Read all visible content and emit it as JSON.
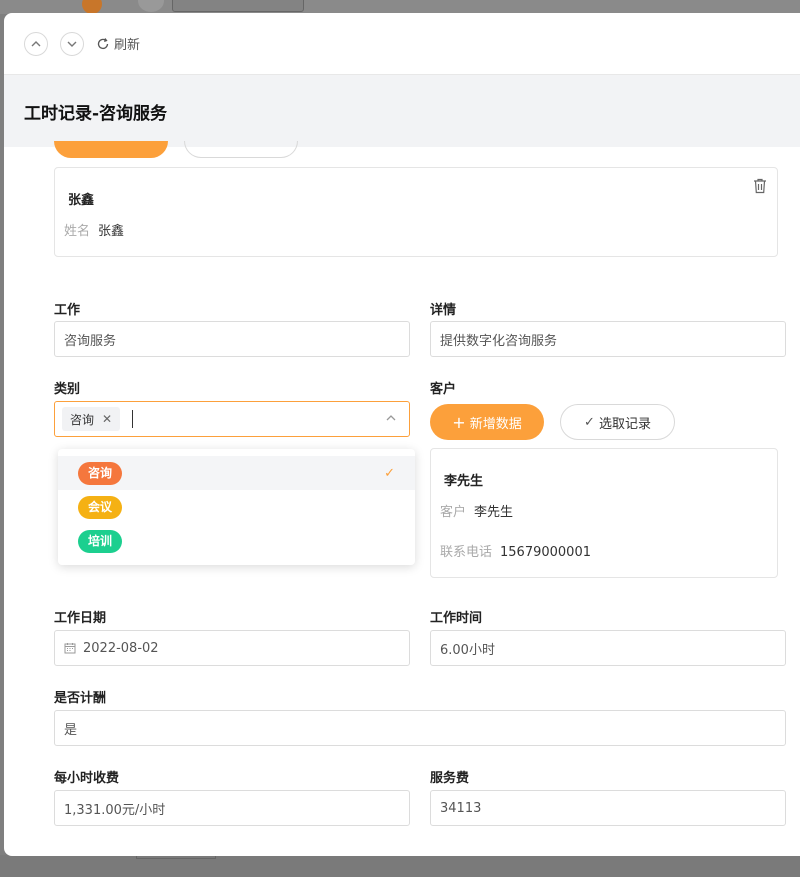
{
  "toolbar": {
    "up_icon": "chevron-up-icon",
    "down_icon": "chevron-down-icon",
    "refresh_label": "刷新"
  },
  "page_title": "工时记录-咨询服务",
  "employee_card": {
    "name": "张鑫",
    "field_label": "姓名",
    "field_value": "张鑫"
  },
  "form": {
    "work": {
      "label": "工作",
      "value": "咨询服务"
    },
    "details": {
      "label": "详情",
      "value": "提供数字化咨询服务"
    },
    "category": {
      "label": "类别",
      "selected_tag": "咨询",
      "options": [
        {
          "label": "咨询",
          "color": "#f5773d",
          "selected": true
        },
        {
          "label": "会议",
          "color": "#f5b114",
          "selected": false
        },
        {
          "label": "培训",
          "color": "#1ccf8f",
          "selected": false
        }
      ]
    },
    "customer": {
      "label": "客户",
      "add_button": "新增数据",
      "select_button": "选取记录",
      "card": {
        "name": "李先生",
        "customer_label": "客户",
        "customer_value": "李先生",
        "phone_label": "联系电话",
        "phone_value": "15679000001"
      }
    },
    "work_date": {
      "label": "工作日期",
      "value": "2022-08-02"
    },
    "work_time": {
      "label": "工作时间",
      "value": "6.00小时"
    },
    "billable": {
      "label": "是否计酬",
      "value": "是"
    },
    "hourly_rate": {
      "label": "每小时收费",
      "value": "1,331.00元/小时"
    },
    "service_fee": {
      "label": "服务费",
      "value": "34113"
    }
  },
  "colors": {
    "accent": "#fca03b",
    "border": "#dcdcdc"
  }
}
